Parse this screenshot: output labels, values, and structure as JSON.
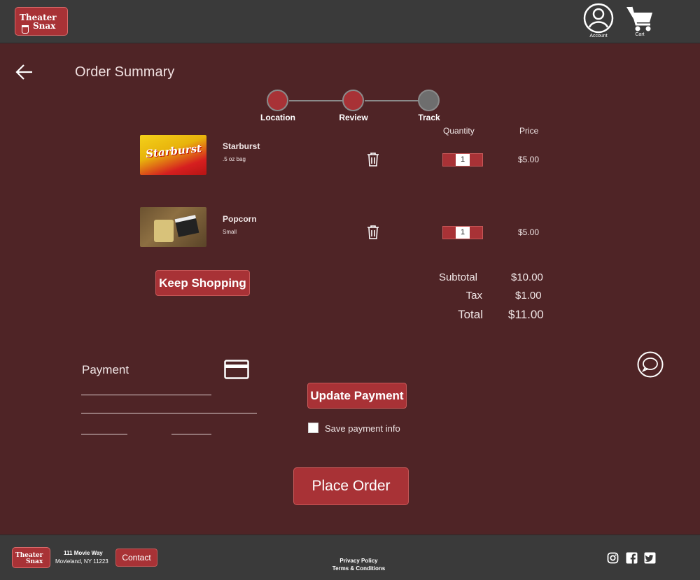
{
  "header": {
    "logo_line1": "Theater",
    "logo_line2": "Snax",
    "account_label": "Account",
    "cart_label": "Cart"
  },
  "page": {
    "title": "Order Summary"
  },
  "stepper": {
    "steps": [
      {
        "label": "Location",
        "state": "complete"
      },
      {
        "label": "Review",
        "state": "active"
      },
      {
        "label": "Track",
        "state": "pending"
      }
    ]
  },
  "columns": {
    "quantity": "Quantity",
    "price": "Price"
  },
  "items": [
    {
      "name": "Starburst",
      "desc": ".5 oz bag",
      "quantity": "1",
      "price": "$5.00",
      "image_text": "Starburst"
    },
    {
      "name": "Popcorn",
      "desc": "Small",
      "quantity": "1",
      "price": "$5.00"
    }
  ],
  "actions": {
    "keep_shopping": "Keep Shopping",
    "update_payment": "Update Payment",
    "place_order": "Place Order"
  },
  "summary": {
    "subtotal_label": "Subtotal",
    "subtotal": "$10.00",
    "tax_label": "Tax",
    "tax": "$1.00",
    "total_label": "Total",
    "total": "$11.00"
  },
  "payment": {
    "title": "Payment",
    "save_label": "Save payment info"
  },
  "footer": {
    "logo_line1": "Theater",
    "logo_line2": "Snax",
    "address_line1": "111 Movie Way",
    "address_line2": "Movieland, NY 11223",
    "contact": "Contact",
    "privacy": "Privacy Policy",
    "terms": "Terms & Conditions"
  },
  "colors": {
    "background": "#4f2426",
    "bar": "#3a3a3a",
    "accent": "#a83236",
    "step_inactive": "#6e6e6e"
  },
  "icons": [
    "back-arrow-icon",
    "account-icon",
    "cart-icon",
    "trash-icon",
    "credit-card-icon",
    "chat-icon",
    "instagram-icon",
    "facebook-icon",
    "twitter-icon"
  ]
}
